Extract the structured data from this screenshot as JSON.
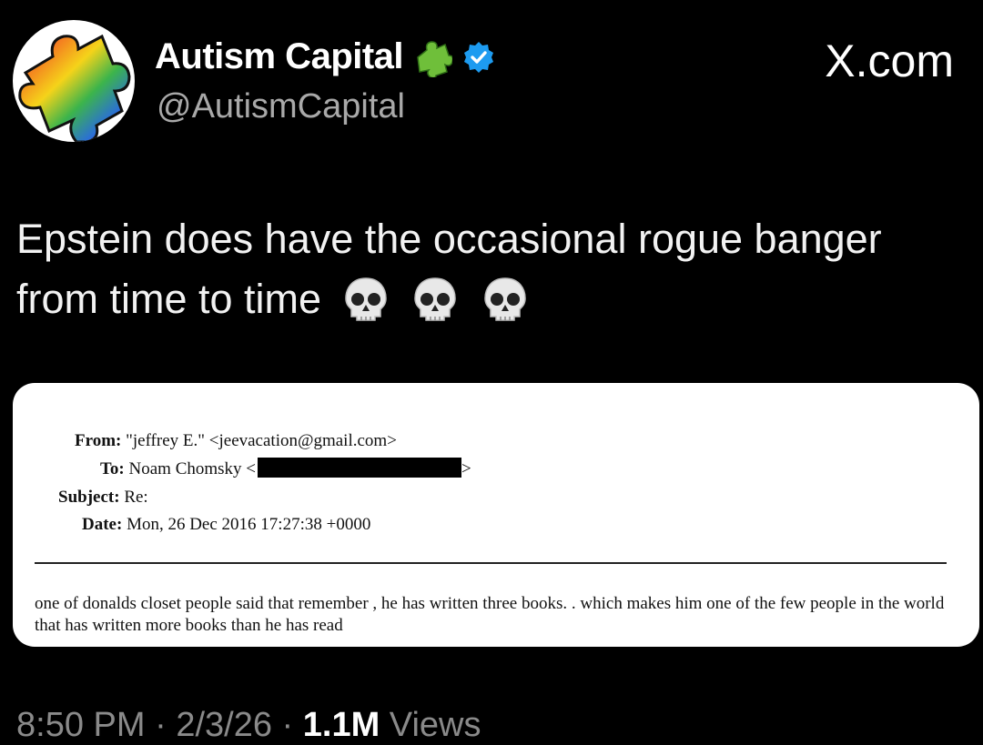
{
  "author": {
    "display_name": "Autism Capital",
    "handle": "@AutismCapital",
    "avatar_icon": "rainbow-puzzle-piece",
    "badges": [
      "puzzle-piece-icon",
      "verified-badge-icon"
    ],
    "verified_color": "#1d9bf0"
  },
  "site_label": "X.com",
  "tweet": {
    "text": "Epstein does have the occasional rogue banger from time to time",
    "emojis": [
      "skull-icon",
      "skull-icon",
      "skull-icon"
    ]
  },
  "email": {
    "from_label": "From:",
    "from_value": "\"jeffrey E.\" <jeevacation@gmail.com>",
    "to_label": "To:",
    "to_value": "Noam Chomsky <",
    "to_suffix": ">",
    "subject_label": "Subject:",
    "subject_value": "Re:",
    "date_label": "Date:",
    "date_value": "Mon, 26 Dec 2016 17:27:38 +0000",
    "body": "one of donalds closet people said that  remember ,   he has written three books.    . which makes him one of the few people in the world that has written more books than he has read"
  },
  "meta": {
    "time": "8:50 PM",
    "sep1": " · ",
    "date": "2/3/26",
    "sep2": " · ",
    "views_count": "1.1M",
    "views_label": " Views"
  }
}
